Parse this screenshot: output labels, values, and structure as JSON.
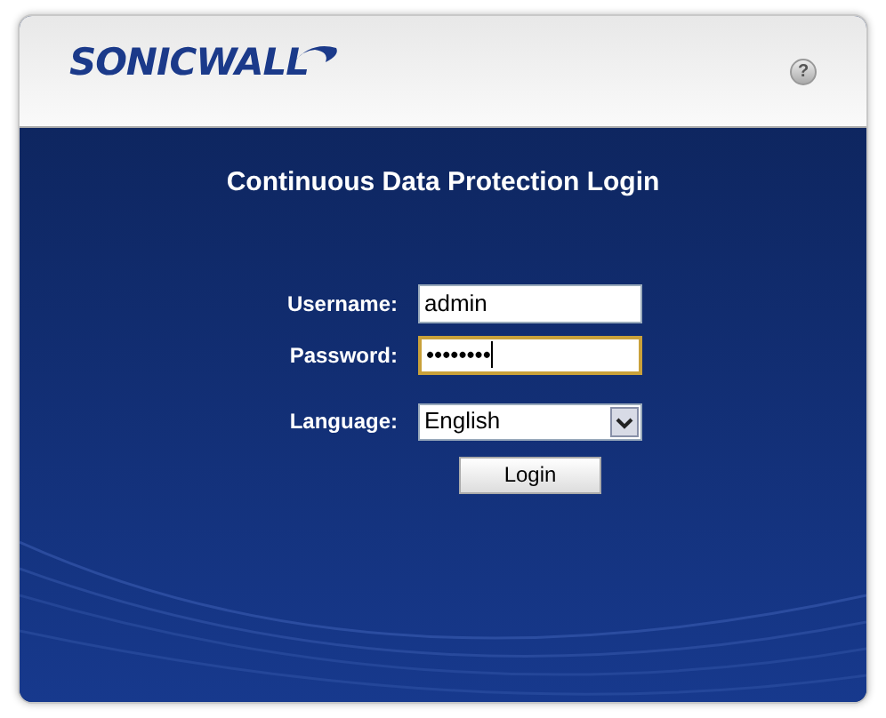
{
  "header": {
    "logo": "SONICWALL",
    "help": "?"
  },
  "title": "Continuous Data Protection Login",
  "fields": [
    {
      "kind": "text",
      "label": "Username:",
      "value": "admin",
      "focused": false
    },
    {
      "kind": "password",
      "label": "Password:",
      "value": "••••••••",
      "focused": true
    },
    {
      "kind": "select",
      "label": "Language:",
      "value": "English",
      "focused": false
    }
  ],
  "button": "Login"
}
